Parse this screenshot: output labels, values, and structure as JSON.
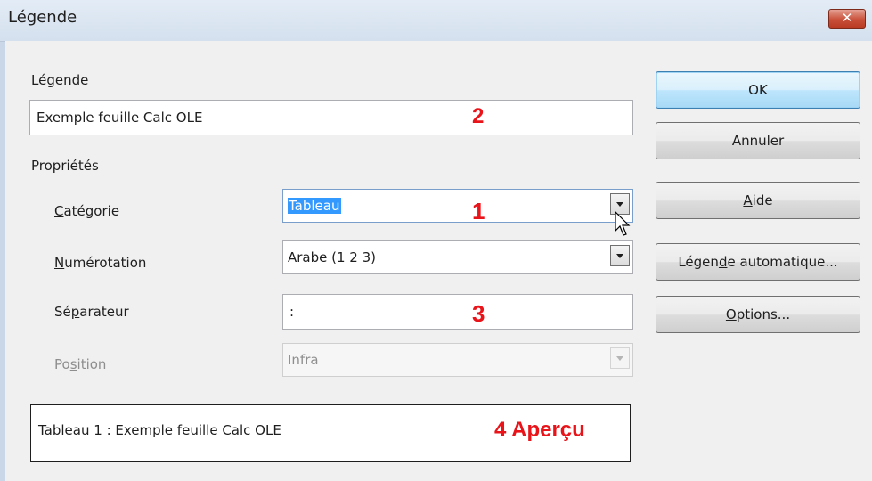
{
  "window": {
    "title": "Légende",
    "close_glyph": "✕"
  },
  "caption": {
    "label_first": "L",
    "label_rest": "égende",
    "value": "Exemple feuille Calc OLE",
    "annotation": "2"
  },
  "properties": {
    "heading": "Propriétés",
    "category": {
      "label_first": "C",
      "label_rest": "atégorie",
      "value": "Tableau",
      "annotation": "1"
    },
    "numbering": {
      "label_first": "N",
      "label_rest": "umérotation",
      "value": "Arabe (1 2 3)"
    },
    "separator": {
      "label_pre": "Sé",
      "label_u": "p",
      "label_post": "arateur",
      "value": ":",
      "annotation": "3"
    },
    "position": {
      "label_pre": "Po",
      "label_u": "s",
      "label_post": "ition",
      "value": "Infra"
    }
  },
  "preview": {
    "text": "Tableau 1 : Exemple feuille Calc OLE",
    "annotation": "4 Aperçu"
  },
  "buttons": {
    "ok": "OK",
    "cancel": "Annuler",
    "help_u": "A",
    "help_rest": "ide",
    "autocaption_pre": "Légen",
    "autocaption_u": "d",
    "autocaption_post": "e automatique...",
    "options_u": "O",
    "options_rest": "ptions..."
  },
  "colors": {
    "annotation": "#e8141a",
    "selection": "#3399ff",
    "default_button": "#3c7fb1"
  }
}
